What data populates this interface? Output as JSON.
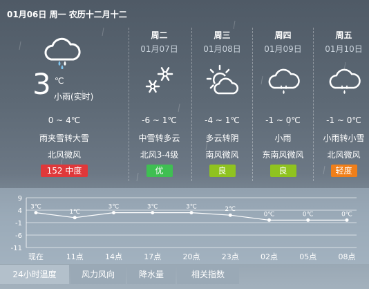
{
  "header": {
    "date_line": "01月06日 周一 农历十二月十二"
  },
  "today": {
    "temp": "3",
    "unit": "℃",
    "condition_now": "小雨(实时)",
    "range": "0 ~ 4℃",
    "desc": "雨夹雪转大雪",
    "wind": "北风微风",
    "aqi": "152  中度",
    "aqi_color": "#e0383a",
    "icon": "cloud-rain-icon"
  },
  "forecast": [
    {
      "day": "周二",
      "date": "01月07日",
      "range": "-6 ~ 1℃",
      "desc": "中雪转多云",
      "wind": "北风3-4级",
      "aqi": "优",
      "aqi_color": "#3fbf52",
      "icon": "snow-icon"
    },
    {
      "day": "周三",
      "date": "01月08日",
      "range": "-4 ~ 1℃",
      "desc": "多云转阴",
      "wind": "南风微风",
      "aqi": "良",
      "aqi_color": "#8fc31f",
      "icon": "sun-cloud-icon"
    },
    {
      "day": "周四",
      "date": "01月09日",
      "range": "-1 ~ 0℃",
      "desc": "小雨",
      "wind": "东南风微风",
      "aqi": "良",
      "aqi_color": "#8fc31f",
      "icon": "cloud-rain-icon"
    },
    {
      "day": "周五",
      "date": "01月10日",
      "range": "-1 ~ 0℃",
      "desc": "小雨转小雪",
      "wind": "北风微风",
      "aqi": "轻度",
      "aqi_color": "#f07f1a",
      "icon": "cloud-rain-icon"
    }
  ],
  "chart_data": {
    "type": "line",
    "categories": [
      "现在",
      "11点",
      "14点",
      "17点",
      "20点",
      "23点",
      "02点",
      "05点",
      "08点"
    ],
    "values": [
      3,
      1,
      3,
      3,
      3,
      2,
      0,
      0,
      0
    ],
    "value_labels": [
      "3℃",
      "1℃",
      "3℃",
      "3℃",
      "3℃",
      "2℃",
      "0℃",
      "0℃",
      "0℃"
    ],
    "y_ticks": [
      "9",
      "4",
      "-1",
      "-6",
      "-11"
    ],
    "ylim": [
      -11,
      9
    ],
    "grid": true
  },
  "tabs": [
    {
      "label": "24小时温度",
      "active": true
    },
    {
      "label": "风力风向",
      "active": false
    },
    {
      "label": "降水量",
      "active": false
    },
    {
      "label": "相关指数",
      "active": false
    }
  ]
}
